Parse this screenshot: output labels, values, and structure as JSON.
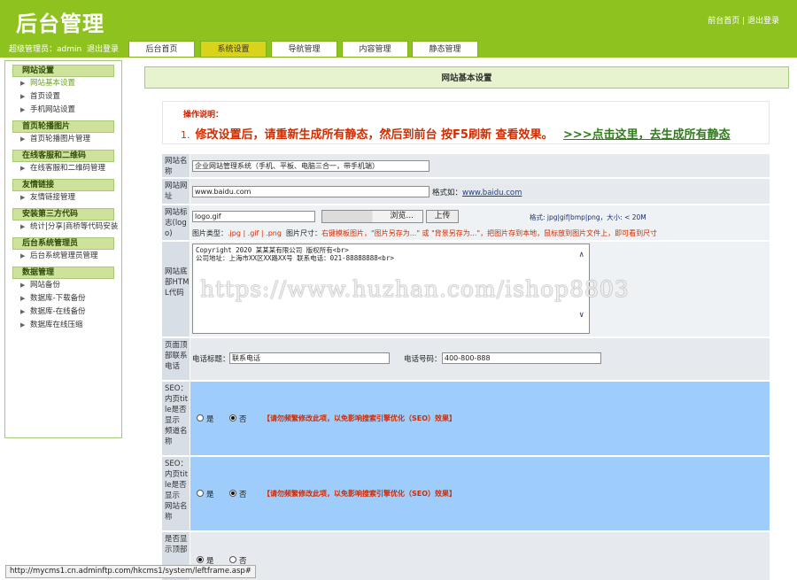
{
  "header": {
    "logo": "后台管理",
    "front_link": "前台首页",
    "separator": " | ",
    "logout_link": "退出登录",
    "user_label": "超级管理员：admin",
    "user_logout": "退出登录"
  },
  "tabs": [
    {
      "label": "后台首页",
      "active": false
    },
    {
      "label": "系统设置",
      "active": true
    },
    {
      "label": "导航管理",
      "active": false
    },
    {
      "label": "内容管理",
      "active": false
    },
    {
      "label": "静态管理",
      "active": false
    }
  ],
  "sidebar": [
    {
      "title": "网站设置",
      "items": [
        {
          "label": "网站基本设置",
          "active": true
        },
        {
          "label": "首页设置",
          "active": false
        },
        {
          "label": "手机网站设置",
          "active": false
        }
      ]
    },
    {
      "title": "首页轮播图片",
      "items": [
        {
          "label": "首页轮播图片管理",
          "active": false
        }
      ]
    },
    {
      "title": "在线客服和二维码",
      "items": [
        {
          "label": "在线客服和二维码管理",
          "active": false
        }
      ]
    },
    {
      "title": "友情链接",
      "items": [
        {
          "label": "友情链接管理",
          "active": false
        }
      ]
    },
    {
      "title": "安装第三方代码",
      "items": [
        {
          "label": "统计|分享|商桥等代码安装",
          "active": false
        }
      ]
    },
    {
      "title": "后台系统管理员",
      "items": [
        {
          "label": "后台系统管理员管理",
          "active": false
        }
      ]
    },
    {
      "title": "数据管理",
      "items": [
        {
          "label": "网站备份",
          "active": false
        },
        {
          "label": "数据库-下载备份",
          "active": false
        },
        {
          "label": "数据库-在线备份",
          "active": false
        },
        {
          "label": "数据库在线压缩",
          "active": false
        }
      ]
    }
  ],
  "main": {
    "title": "网站基本设置",
    "notice_title": "操作说明：",
    "notice_num": "1.",
    "notice_text": "修改设置后，请重新生成所有静态，然后到前台 按F5刷新 查看效果。",
    "notice_link": ">>>点击这里，去生成所有静态"
  },
  "form": {
    "site_name": {
      "label": "网站名称",
      "value": "企业网站管理系统（手机、平板、电脑三合一，带手机端）"
    },
    "site_url": {
      "label": "网站网址",
      "value": "www.baidu.com",
      "format_prefix": "格式如：",
      "format_example": "www.baidu.com"
    },
    "logo": {
      "label": "网站标志(logo)",
      "value": "logo.gif",
      "browse_button": "浏览...",
      "upload_button": "上传",
      "format_hint": "格式: jpg|gif|bmp|png，大小: < 20M",
      "type_label": "图片类型：",
      "types": ".jpg | .gif | .png",
      "size_label": "图片尺寸：",
      "size_tip": "右键模板图片，\"图片另存为...\" 或 \"背景另存为...\"，把图片存到本地，鼠标放到图片文件上，即可看到尺寸"
    },
    "footer_html": {
      "label": "网站底部HTML代码",
      "line1": "Copyright 2020 某某某有限公司 版权所有<br>",
      "line2": "公司地址：上海市XX区XX路XX号 联系电话：021-88888888<br>"
    },
    "top_contact": {
      "label": "页面顶部联系电话",
      "title_label": "电话标题：",
      "title_value": "联系电话",
      "number_label": "电话号码：",
      "number_value": "400-800-888"
    },
    "seo_channel": {
      "label": "SEO：内页title是否显示 频道名称",
      "yes": "是",
      "no": "否",
      "selected": "否",
      "tip": "【请勿频繁修改此项，以免影响搜索引擎优化（SEO）效果】"
    },
    "seo_site": {
      "label": "SEO：内页title是否显示 网站名称",
      "yes": "是",
      "no": "否",
      "selected": "否",
      "tip": "【请勿频繁修改此项，以免影响搜索引擎优化（SEO）效果】"
    },
    "show_top": {
      "label": "是否显示顶部",
      "yes": "是",
      "no": "否",
      "selected": "是"
    }
  },
  "watermark": "https://www.huzhan.com/ishop8803",
  "status_url": "http://mycms1.cn.adminftp.com/hkcms1/system/leftframe.asp#"
}
